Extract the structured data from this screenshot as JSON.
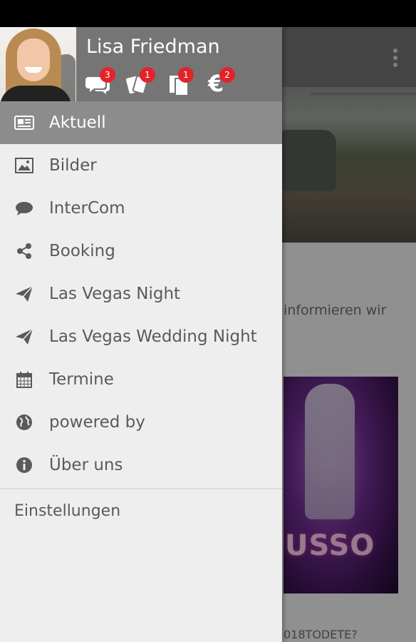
{
  "user": {
    "name": "Lisa Friedman",
    "badges": {
      "messages": "3",
      "cards": "1",
      "documents": "1",
      "euro": "2"
    }
  },
  "menu": {
    "items": [
      {
        "label": "Aktuell",
        "icon": "newspaper-icon",
        "active": true
      },
      {
        "label": "Bilder",
        "icon": "image-icon"
      },
      {
        "label": "InterCom",
        "icon": "chat-bubble-icon"
      },
      {
        "label": "Booking",
        "icon": "share-icon"
      },
      {
        "label": "Las Vegas Night",
        "icon": "paper-plane-icon"
      },
      {
        "label": "Las Vegas Wedding Night",
        "icon": "paper-plane-icon"
      },
      {
        "label": "Termine",
        "icon": "calendar-icon"
      },
      {
        "label": "powered by",
        "icon": "globe-icon"
      },
      {
        "label": "Über uns",
        "icon": "info-icon"
      }
    ],
    "settings_label": "Einstellungen"
  },
  "background": {
    "article_text_line1": "informieren wir",
    "article_text_line2": "",
    "poster_title": "USSO",
    "article_footer": "018TODETE?"
  },
  "colors": {
    "header_bg": "#757575",
    "active_item_bg": "#8c8c8c",
    "badge_red": "#e2242a",
    "drawer_bg": "#eeeeee"
  }
}
